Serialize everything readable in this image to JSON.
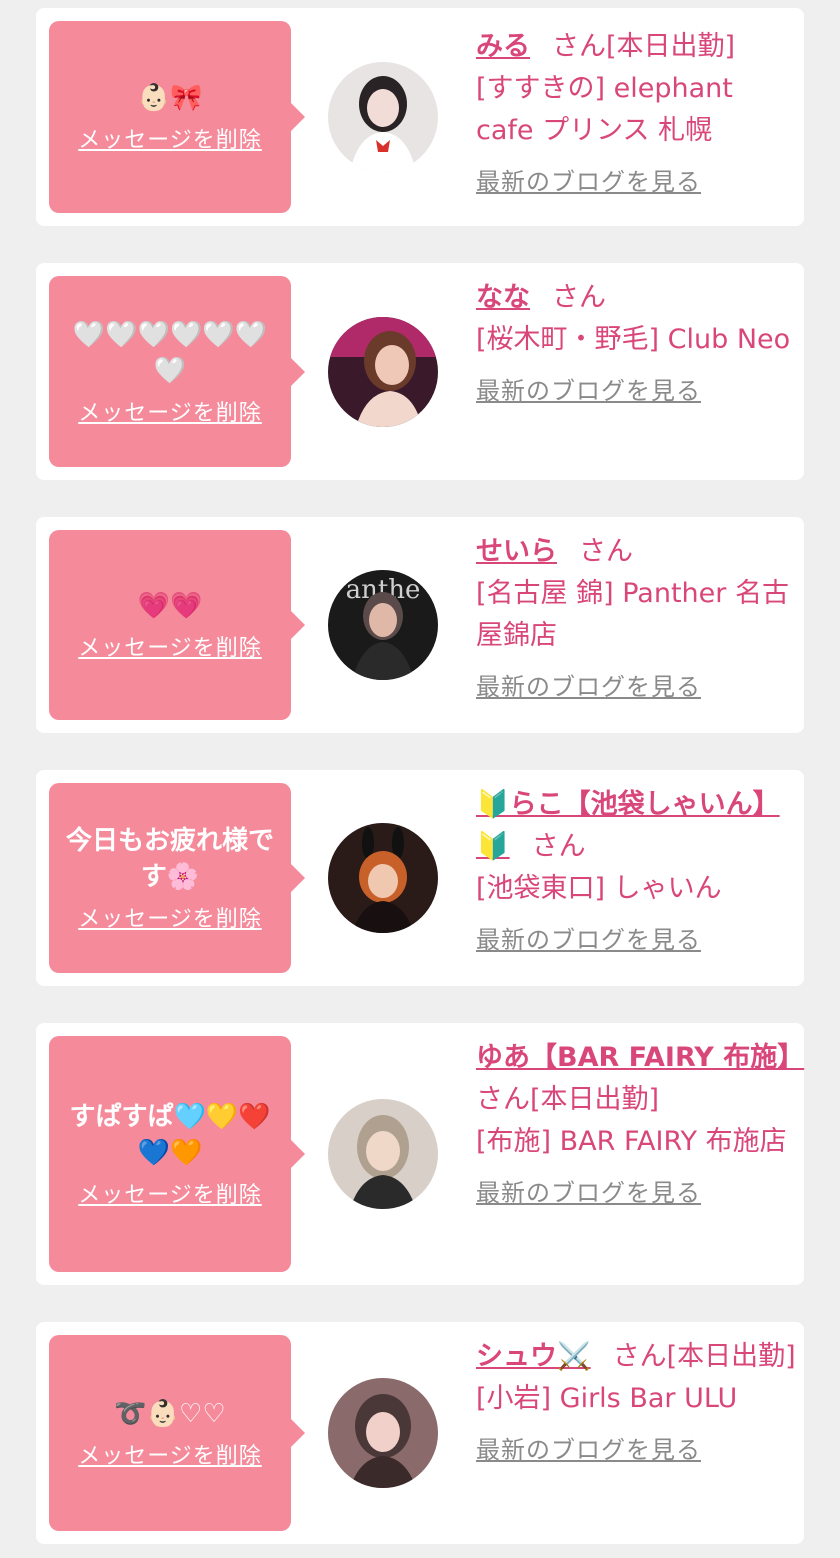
{
  "items": [
    {
      "message": "👶🏻🎀",
      "delete_label": "メッセージを削除",
      "name": "みる",
      "san": "さん",
      "working_today": "[本日出勤]",
      "shop": "[すすきの] elephant cafe プリンス 札幌",
      "blog_label": "最新のブログを見る",
      "avatar_colors": [
        "#e8e4e4",
        "#2a2325",
        "#f2dcd8"
      ]
    },
    {
      "message": "🤍🤍🤍🤍🤍🤍🤍",
      "delete_label": "メッセージを削除",
      "name": "なな",
      "san": "さん",
      "working_today": "",
      "shop": "[桜木町・野毛] Club Neo",
      "blog_label": "最新のブログを見る",
      "avatar_colors": [
        "#b02a6a",
        "#3a1a2a",
        "#f0c8b8"
      ]
    },
    {
      "message": "💗💗",
      "delete_label": "メッセージを削除",
      "name": "せいら",
      "san": "さん",
      "working_today": "",
      "shop": "[名古屋 錦] Panther 名古屋錦店",
      "blog_label": "最新のブログを見る",
      "avatar_colors": [
        "#1a1a1a",
        "#5a4a4a",
        "#e0b8a8"
      ]
    },
    {
      "message": "今日もお疲れ様です🌸",
      "delete_label": "メッセージを削除",
      "name": "🔰らこ【池袋しゃいん】🔰",
      "san": "さん",
      "working_today": "",
      "shop": "[池袋東口] しゃいん",
      "blog_label": "最新のブログを見る",
      "avatar_colors": [
        "#2a1a18",
        "#c8602a",
        "#f0c8b0"
      ]
    },
    {
      "message": "すぱすぱ🩵💛❤️💙🧡",
      "delete_label": "メッセージを削除",
      "name": "ゆあ【BAR FAIRY 布施】",
      "san": "さん",
      "working_today": "[本日出勤]",
      "shop": "[布施] BAR FAIRY 布施店",
      "blog_label": "最新のブログを見る",
      "avatar_colors": [
        "#d8d0c8",
        "#2a2a2a",
        "#f0d8c8"
      ]
    },
    {
      "message": "➰👶🏻♡♡",
      "delete_label": "メッセージを削除",
      "name": "シュウ⚔️",
      "san": "さん",
      "working_today": "[本日出勤]",
      "shop": "[小岩] Girls Bar ULU",
      "blog_label": "最新のブログを見る",
      "avatar_colors": [
        "#8a6a6a",
        "#4a3838",
        "#f0d0c8"
      ]
    }
  ]
}
